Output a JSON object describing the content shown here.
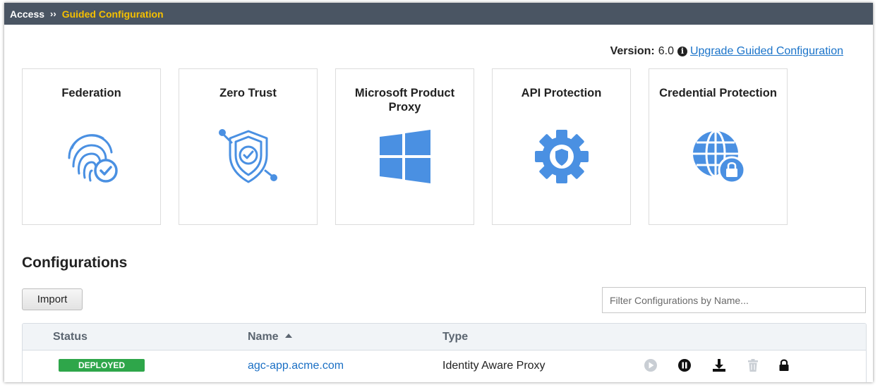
{
  "breadcrumb": {
    "root": "Access",
    "separator": "››",
    "current": "Guided Configuration"
  },
  "version": {
    "label": "Version:",
    "value": "6.0",
    "info_icon": "info-circle-icon",
    "upgrade_link": "Upgrade Guided Configuration"
  },
  "tiles": [
    {
      "title": "Federation",
      "icon": "fingerprint-check-icon"
    },
    {
      "title": "Zero Trust",
      "icon": "shield-check-icon"
    },
    {
      "title": "Microsoft Product Proxy",
      "icon": "windows-logo-icon"
    },
    {
      "title": "API Protection",
      "icon": "gear-shield-icon"
    },
    {
      "title": "Credential Protection",
      "icon": "globe-lock-icon"
    }
  ],
  "configurations": {
    "title": "Configurations",
    "import_label": "Import",
    "filter_placeholder": "Filter Configurations by Name...",
    "filter_value": "",
    "columns": [
      "Status",
      "Name",
      "Type"
    ],
    "sort": {
      "column": "Name",
      "direction": "ascending"
    },
    "rows": [
      {
        "status": "DEPLOYED",
        "name": "agc-app.acme.com",
        "type": "Identity Aware Proxy",
        "actions": [
          {
            "icon": "play-icon",
            "enabled": false
          },
          {
            "icon": "pause-icon",
            "enabled": true
          },
          {
            "icon": "download-icon",
            "enabled": true
          },
          {
            "icon": "trash-icon",
            "enabled": false
          },
          {
            "icon": "lock-icon",
            "enabled": true
          }
        ]
      }
    ]
  },
  "colors": {
    "topbar": "#4a5563",
    "breadcrumb_active": "#f5c000",
    "link": "#1a73c9",
    "icon_blue": "#4a90e2",
    "status_deployed": "#2ea64a"
  }
}
